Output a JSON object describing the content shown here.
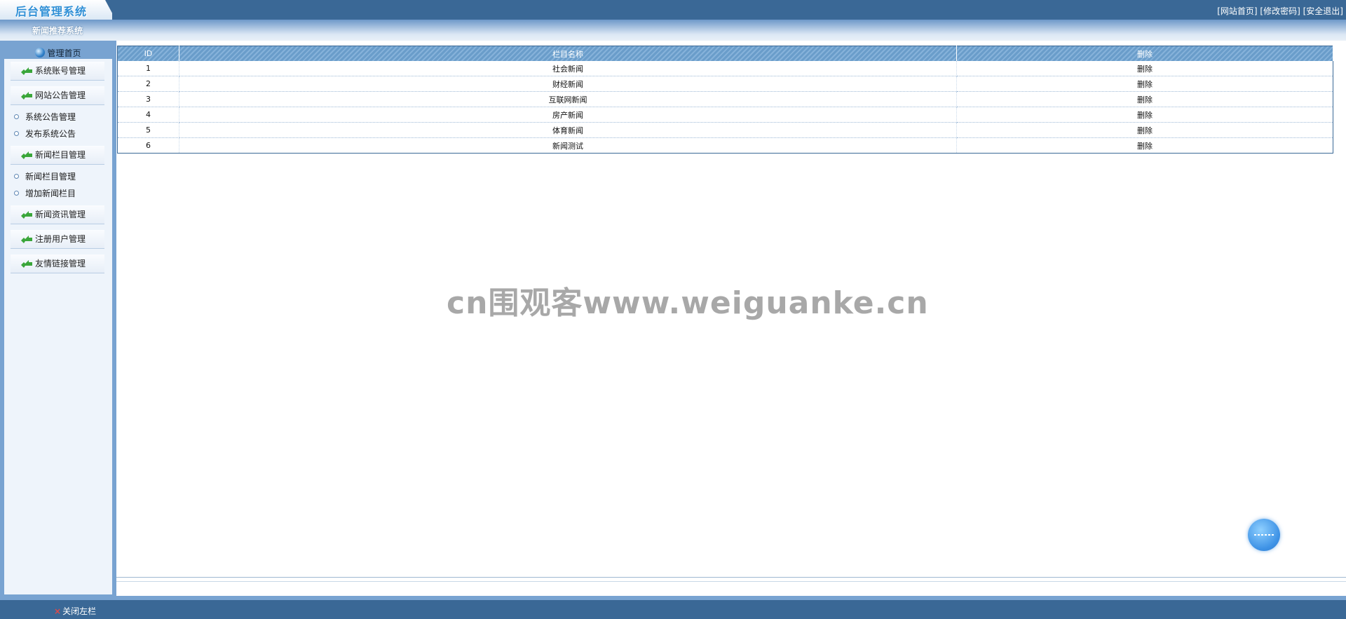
{
  "header": {
    "logo_text": "后台管理系统",
    "links": [
      "[网站首页]",
      "[修改密码]",
      "[安全退出]"
    ]
  },
  "subbar": {
    "title": "新闻推荐系统"
  },
  "sidebar": {
    "home_label": "管理首页",
    "groups": [
      {
        "label": "系统账号管理",
        "items": []
      },
      {
        "label": "网站公告管理",
        "items": [
          "系统公告管理",
          "发布系统公告"
        ]
      },
      {
        "label": "新闻栏目管理",
        "items": [
          "新闻栏目管理",
          "增加新闻栏目"
        ]
      },
      {
        "label": "新闻资讯管理",
        "items": []
      },
      {
        "label": "注册用户管理",
        "items": []
      },
      {
        "label": "友情链接管理",
        "items": []
      }
    ],
    "close_label": "关闭左栏"
  },
  "table": {
    "columns": [
      "ID",
      "栏目名称",
      "删除"
    ],
    "rows": [
      {
        "id": "1",
        "name": "社会新闻",
        "action": "删除"
      },
      {
        "id": "2",
        "name": "财经新闻",
        "action": "删除"
      },
      {
        "id": "3",
        "name": "互联网新闻",
        "action": "删除"
      },
      {
        "id": "4",
        "name": "房产新闻",
        "action": "删除"
      },
      {
        "id": "5",
        "name": "体育新闻",
        "action": "删除"
      },
      {
        "id": "6",
        "name": "新闻测试",
        "action": "删除"
      }
    ]
  },
  "watermark": "cn围观客www.weiguanke.cn",
  "colors": {
    "header_blue": "#3a6896",
    "sidebar_blue": "#78a3d1",
    "table_header": "#6a9dca"
  }
}
